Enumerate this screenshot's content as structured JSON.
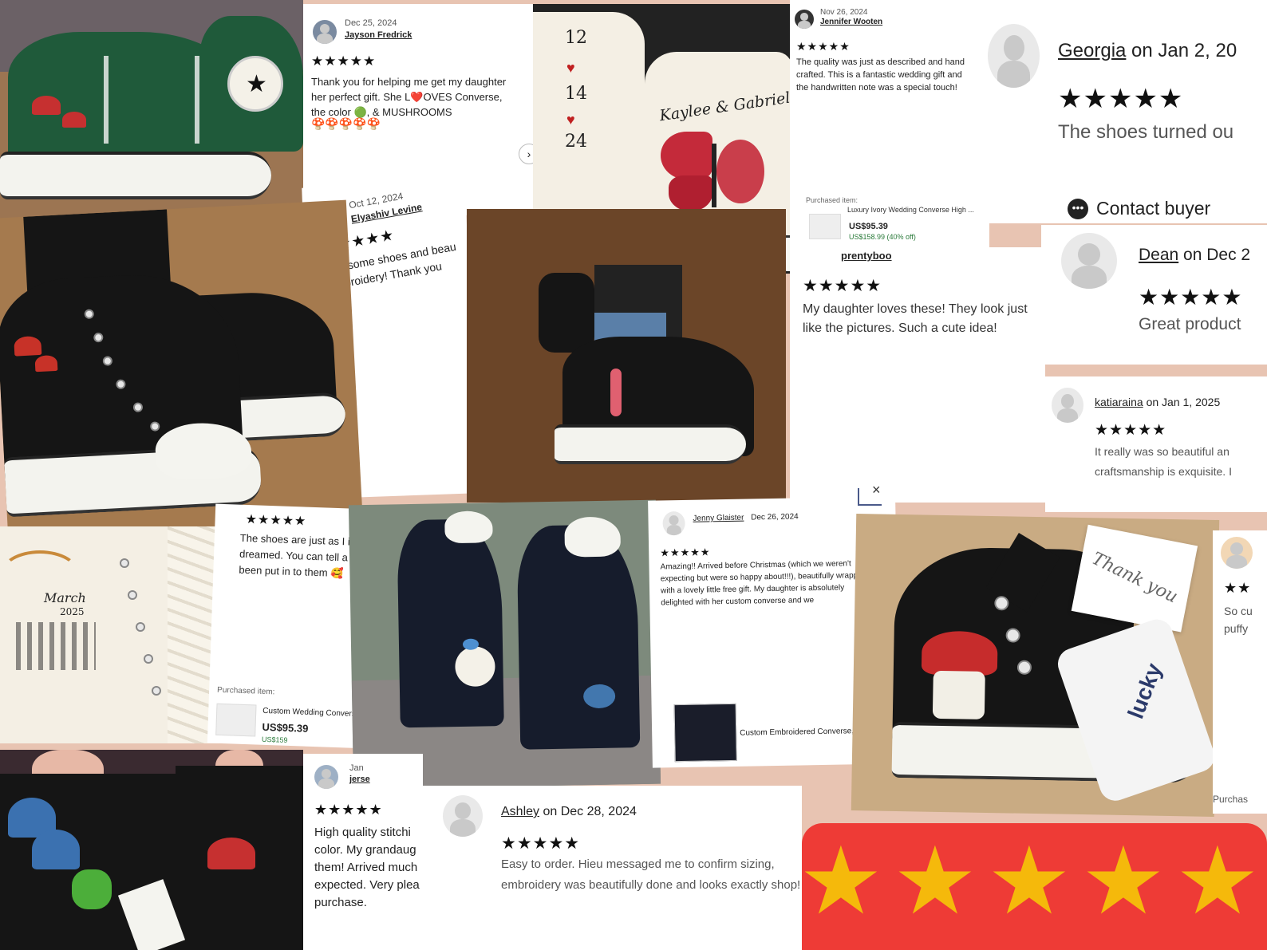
{
  "reviews": {
    "jayson": {
      "date": "Dec 25, 2024",
      "name": "Jayson Fredrick",
      "stars": "★★★★★",
      "text": "Thank you for helping me get my daughter her perfect gift. She L❤️OVES Converse, the color 🟢, & MUSHROOMS",
      "emoji": "🍄🍄🍄🍄🍄"
    },
    "elyashiv": {
      "date": "Oct 12, 2024",
      "name": "Elyashiv Levine",
      "stars": "★★★★★",
      "text": "Awesome shoes and beau embroidery! Thank you"
    },
    "jennifer": {
      "date": "Nov 26, 2024",
      "name": "Jennifer Wooten",
      "stars": "★★★★★",
      "text": "The quality was just as described and hand crafted. This is a fantastic wedding gift and the handwritten note was a special touch!",
      "purchased_label": "Purchased item:",
      "item_name": "Luxury Ivory Wedding Converse High ...",
      "price": "US$95.39",
      "old_price": "US$158.99 (40% off)"
    },
    "georgia": {
      "name": "Georgia",
      "on": " on Jan 2, 20",
      "stars": "★★★★★",
      "text": "The shoes turned ou"
    },
    "contact": {
      "label": "Contact buyer"
    },
    "dean": {
      "name": "Dean",
      "on": " on Dec 2",
      "stars": "★★★★★",
      "text": "Great product"
    },
    "prentyboo": {
      "name": "prentyboo",
      "stars": "★★★★★",
      "text": "My daughter loves these! They look just like the pictures. Such a cute idea!"
    },
    "katiaraina": {
      "name": "katiaraina",
      "on": " on Jan 1, 2025",
      "stars": "★★★★★",
      "text": "It really was so beautiful an craftsmanship is exquisite. I"
    },
    "dreamed": {
      "stars": "★★★★★",
      "text": "The shoes are just as I in dreamed. You can tell a l been put in to them 🥰",
      "purchased_label": "Purchased item:",
      "item_name": "Custom Wedding Convers",
      "price": "US$95.39",
      "old_price": "US$159"
    },
    "jenny": {
      "name": "Jenny Glaister",
      "date": "Dec 26, 2024",
      "stars": "★★★★★",
      "text": "Amazing!! Arrived before Christmas (which we weren't expecting but were so happy about!!!), beautifully wrapped with a lovely little free gift. My daughter is absolutely delighted with her custom converse and we",
      "item_name": "Custom Embroidered Converse, Hamm...",
      "close": "×"
    },
    "jersey": {
      "date": "Jan",
      "name": "jerse",
      "stars": "★★★★★",
      "text": "High quality stitchi color. My grandaug them! Arrived much expected. Very plea purchase."
    },
    "ashley": {
      "name": "Ashley",
      "on": " on Dec 28, 2024",
      "stars": "★★★★★",
      "text": "Easy to order. Hieu messaged me to confirm sizing, embroidery was beautifully done and looks exactly shop!"
    },
    "rightedge": {
      "stars": "★★",
      "text": "So cu puffy",
      "purchased_label": "Purchas"
    }
  },
  "photo_text": {
    "wedding_names": "Kaylee & Gabriel",
    "heel_numbers": [
      "12",
      "14",
      "24"
    ],
    "calendar_month": "March",
    "calendar_year": "2025",
    "thank_you": "Thank you",
    "lucky": "lucky"
  },
  "banner": {
    "stars": [
      "★",
      "★",
      "★",
      "★",
      "★"
    ],
    "bg": "#ee3b36",
    "star_color": "#f5b90b"
  },
  "colors": {
    "page_bg": "#e8c4b2",
    "green_shoe": "#1f5a3a",
    "black_shoe": "#151515",
    "ivory": "#f4efe4"
  }
}
